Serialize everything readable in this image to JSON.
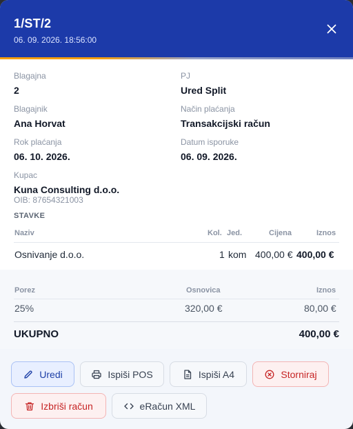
{
  "header": {
    "title": "1/ST/2",
    "subtitle": "06. 09. 2026. 18:56:00"
  },
  "fields": {
    "blagajna": {
      "label": "Blagajna",
      "value": "2"
    },
    "pj": {
      "label": "PJ",
      "value": "Ured Split"
    },
    "blagajnik": {
      "label": "Blagajnik",
      "value": "Ana Horvat"
    },
    "nacin_placanja": {
      "label": "Način plaćanja",
      "value": "Transakcijski račun"
    },
    "rok_placanja": {
      "label": "Rok plaćanja",
      "value": "06. 10. 2026."
    },
    "datum_isporuke": {
      "label": "Datum isporuke",
      "value": "06. 09. 2026."
    },
    "kupac": {
      "label": "Kupac",
      "value": "Kuna Consulting d.o.o.",
      "oib": "OIB: 87654321003"
    }
  },
  "items": {
    "section_title": "STAVKE",
    "headers": {
      "naziv": "Naziv",
      "kol": "Kol.",
      "jed": "Jed.",
      "cijena": "Cijena",
      "iznos": "Iznos"
    },
    "rows": [
      {
        "naziv": "Osnivanje d.o.o.",
        "kol": "1",
        "jed": "kom",
        "cijena": "400,00 €",
        "iznos": "400,00 €"
      }
    ]
  },
  "tax": {
    "headers": {
      "porez": "Porez",
      "osnovica": "Osnovica",
      "iznos": "Iznos"
    },
    "rows": [
      {
        "porez": "25%",
        "osnovica": "320,00 €",
        "iznos": "80,00 €"
      }
    ]
  },
  "total": {
    "label": "UKUPNO",
    "value": "400,00 €"
  },
  "actions": {
    "uredi": "Uredi",
    "ispisi_pos": "Ispiši POS",
    "ispisi_a4": "Ispiši A4",
    "storniraj": "Storniraj",
    "izbrisi": "Izbriši račun",
    "eracun": "eRačun XML"
  },
  "colors": {
    "header_bg": "#1c3aa9",
    "accent": "#f59e0b",
    "primary": "#1d3fa6",
    "danger": "#c62424"
  },
  "icons": {
    "close": "close-icon",
    "uredi": "pencil-icon",
    "ispisi_pos": "printer-icon",
    "ispisi_a4": "document-icon",
    "storniraj": "x-circle-icon",
    "izbrisi": "trash-icon",
    "eracun": "code-icon"
  }
}
